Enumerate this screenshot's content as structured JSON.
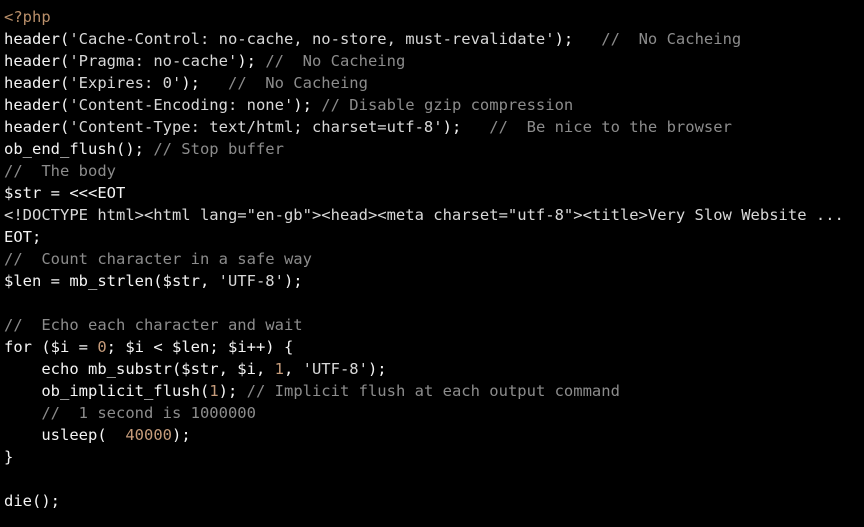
{
  "window": {
    "title": "PHP Source Listing",
    "background_color": "#000000",
    "default_text_color": "#f2f2f2"
  },
  "theme": {
    "tag_color": "#b98f6a",
    "code_color": "#f4f4f4",
    "string_color": "#d8d8d8",
    "comment_color": "#8c8c8c",
    "number_color": "#c69c7b"
  },
  "code": {
    "language": "php",
    "lines": [
      {
        "index": 1,
        "text": "<?php",
        "segments": [
          {
            "kind": "tag",
            "text": "<?php"
          }
        ]
      },
      {
        "index": 2,
        "text": "header('Cache-Control: no-cache, no-store, must-revalidate');   //  No Cacheing",
        "segments": [
          {
            "kind": "code",
            "text": "header("
          },
          {
            "kind": "string",
            "text": "'Cache-Control: no-cache, no-store, must-revalidate'"
          },
          {
            "kind": "code",
            "text": ");   "
          },
          {
            "kind": "comment",
            "text": "//  No Cacheing"
          }
        ]
      },
      {
        "index": 3,
        "text": "header('Pragma: no-cache'); //  No Cacheing",
        "segments": [
          {
            "kind": "code",
            "text": "header("
          },
          {
            "kind": "string",
            "text": "'Pragma: no-cache'"
          },
          {
            "kind": "code",
            "text": "); "
          },
          {
            "kind": "comment",
            "text": "//  No Cacheing"
          }
        ]
      },
      {
        "index": 4,
        "text": "header('Expires: 0');   //  No Cacheing",
        "segments": [
          {
            "kind": "code",
            "text": "header("
          },
          {
            "kind": "string",
            "text": "'Expires: 0'"
          },
          {
            "kind": "code",
            "text": ");   "
          },
          {
            "kind": "comment",
            "text": "//  No Cacheing"
          }
        ]
      },
      {
        "index": 5,
        "text": "header('Content-Encoding: none'); // Disable gzip compression",
        "segments": [
          {
            "kind": "code",
            "text": "header("
          },
          {
            "kind": "string",
            "text": "'Content-Encoding: none'"
          },
          {
            "kind": "code",
            "text": "); "
          },
          {
            "kind": "comment",
            "text": "// Disable gzip compression"
          }
        ]
      },
      {
        "index": 6,
        "text": "header('Content-Type: text/html; charset=utf-8');   //  Be nice to the browser",
        "segments": [
          {
            "kind": "code",
            "text": "header("
          },
          {
            "kind": "string",
            "text": "'Content-Type: text/html; charset=utf-8'"
          },
          {
            "kind": "code",
            "text": ");   "
          },
          {
            "kind": "comment",
            "text": "//  Be nice to the browser"
          }
        ]
      },
      {
        "index": 7,
        "text": "ob_end_flush(); // Stop buffer",
        "segments": [
          {
            "kind": "code",
            "text": "ob_end_flush(); "
          },
          {
            "kind": "comment",
            "text": "// Stop buffer"
          }
        ]
      },
      {
        "index": 8,
        "text": "//  The body",
        "segments": [
          {
            "kind": "comment",
            "text": "//  The body"
          }
        ]
      },
      {
        "index": 9,
        "text": "$str = <<<EOT",
        "segments": [
          {
            "kind": "code",
            "text": "$str = <<<EOT"
          }
        ]
      },
      {
        "index": 10,
        "text": "<!DOCTYPE html><html lang=\"en-gb\"><head><meta charset=\"utf-8\"><title>Very Slow Website ...",
        "segments": [
          {
            "kind": "string",
            "text": "<!DOCTYPE html><html lang=\"en-gb\"><head><meta charset=\"utf-8\"><title>Very Slow Website ..."
          }
        ]
      },
      {
        "index": 11,
        "text": "EOT;",
        "segments": [
          {
            "kind": "code",
            "text": "EOT;"
          }
        ]
      },
      {
        "index": 12,
        "text": "//  Count character in a safe way",
        "segments": [
          {
            "kind": "comment",
            "text": "//  Count character in a safe way"
          }
        ]
      },
      {
        "index": 13,
        "text": "$len = mb_strlen($str, 'UTF-8');",
        "segments": [
          {
            "kind": "code",
            "text": "$len = mb_strlen($str, "
          },
          {
            "kind": "string",
            "text": "'UTF-8'"
          },
          {
            "kind": "code",
            "text": ");"
          }
        ]
      },
      {
        "index": 14,
        "text": "",
        "blank": true,
        "segments": []
      },
      {
        "index": 15,
        "text": "//  Echo each character and wait",
        "segments": [
          {
            "kind": "comment",
            "text": "//  Echo each character and wait"
          }
        ]
      },
      {
        "index": 16,
        "text": "for ($i = 0; $i < $len; $i++) {",
        "segments": [
          {
            "kind": "code",
            "text": "for ($i = "
          },
          {
            "kind": "number",
            "text": "0"
          },
          {
            "kind": "code",
            "text": "; $i < $len; $i++) {"
          }
        ]
      },
      {
        "index": 17,
        "text": "    echo mb_substr($str, $i, 1, 'UTF-8');",
        "segments": [
          {
            "kind": "code",
            "text": "    echo mb_substr($str, $i, "
          },
          {
            "kind": "number",
            "text": "1"
          },
          {
            "kind": "code",
            "text": ", "
          },
          {
            "kind": "string",
            "text": "'UTF-8'"
          },
          {
            "kind": "code",
            "text": ");"
          }
        ]
      },
      {
        "index": 18,
        "text": "    ob_implicit_flush(1); // Implicit flush at each output command",
        "segments": [
          {
            "kind": "code",
            "text": "    ob_implicit_flush("
          },
          {
            "kind": "number",
            "text": "1"
          },
          {
            "kind": "code",
            "text": "); "
          },
          {
            "kind": "comment",
            "text": "// Implicit flush at each output command"
          }
        ]
      },
      {
        "index": 19,
        "text": "    //  1 second is 1000000",
        "segments": [
          {
            "kind": "comment",
            "text": "    //  1 second is 1000000"
          }
        ]
      },
      {
        "index": 20,
        "text": "    usleep(  40000);",
        "segments": [
          {
            "kind": "code",
            "text": "    usleep(  "
          },
          {
            "kind": "number",
            "text": "40000"
          },
          {
            "kind": "code",
            "text": ");"
          }
        ]
      },
      {
        "index": 21,
        "text": "}",
        "segments": [
          {
            "kind": "code",
            "text": "}"
          }
        ]
      },
      {
        "index": 22,
        "text": "",
        "blank": true,
        "segments": []
      },
      {
        "index": 23,
        "text": "die();",
        "segments": [
          {
            "kind": "code",
            "text": "die();"
          }
        ]
      }
    ]
  }
}
